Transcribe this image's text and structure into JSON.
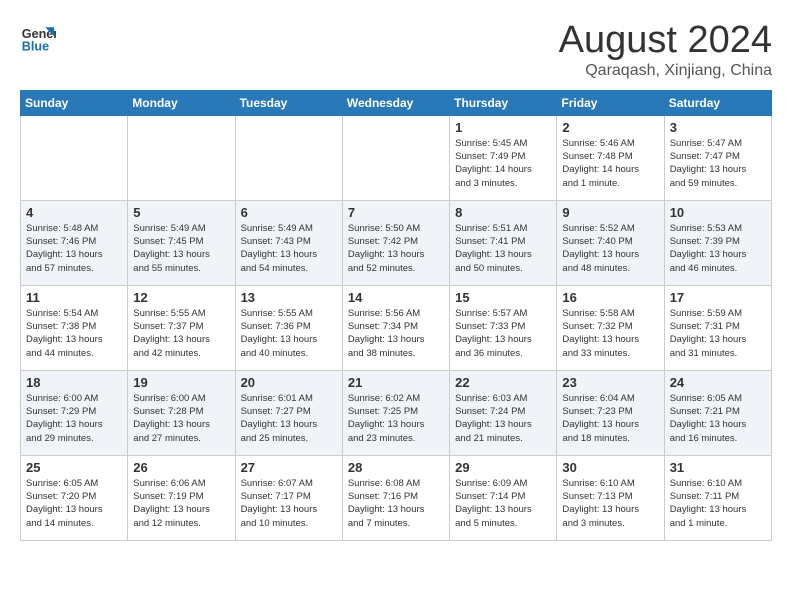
{
  "header": {
    "logo_line1": "General",
    "logo_line2": "Blue",
    "month": "August 2024",
    "location": "Qaraqash, Xinjiang, China"
  },
  "weekdays": [
    "Sunday",
    "Monday",
    "Tuesday",
    "Wednesday",
    "Thursday",
    "Friday",
    "Saturday"
  ],
  "weeks": [
    [
      {
        "day": "",
        "info": ""
      },
      {
        "day": "",
        "info": ""
      },
      {
        "day": "",
        "info": ""
      },
      {
        "day": "",
        "info": ""
      },
      {
        "day": "1",
        "info": "Sunrise: 5:45 AM\nSunset: 7:49 PM\nDaylight: 14 hours\nand 3 minutes."
      },
      {
        "day": "2",
        "info": "Sunrise: 5:46 AM\nSunset: 7:48 PM\nDaylight: 14 hours\nand 1 minute."
      },
      {
        "day": "3",
        "info": "Sunrise: 5:47 AM\nSunset: 7:47 PM\nDaylight: 13 hours\nand 59 minutes."
      }
    ],
    [
      {
        "day": "4",
        "info": "Sunrise: 5:48 AM\nSunset: 7:46 PM\nDaylight: 13 hours\nand 57 minutes."
      },
      {
        "day": "5",
        "info": "Sunrise: 5:49 AM\nSunset: 7:45 PM\nDaylight: 13 hours\nand 55 minutes."
      },
      {
        "day": "6",
        "info": "Sunrise: 5:49 AM\nSunset: 7:43 PM\nDaylight: 13 hours\nand 54 minutes."
      },
      {
        "day": "7",
        "info": "Sunrise: 5:50 AM\nSunset: 7:42 PM\nDaylight: 13 hours\nand 52 minutes."
      },
      {
        "day": "8",
        "info": "Sunrise: 5:51 AM\nSunset: 7:41 PM\nDaylight: 13 hours\nand 50 minutes."
      },
      {
        "day": "9",
        "info": "Sunrise: 5:52 AM\nSunset: 7:40 PM\nDaylight: 13 hours\nand 48 minutes."
      },
      {
        "day": "10",
        "info": "Sunrise: 5:53 AM\nSunset: 7:39 PM\nDaylight: 13 hours\nand 46 minutes."
      }
    ],
    [
      {
        "day": "11",
        "info": "Sunrise: 5:54 AM\nSunset: 7:38 PM\nDaylight: 13 hours\nand 44 minutes."
      },
      {
        "day": "12",
        "info": "Sunrise: 5:55 AM\nSunset: 7:37 PM\nDaylight: 13 hours\nand 42 minutes."
      },
      {
        "day": "13",
        "info": "Sunrise: 5:55 AM\nSunset: 7:36 PM\nDaylight: 13 hours\nand 40 minutes."
      },
      {
        "day": "14",
        "info": "Sunrise: 5:56 AM\nSunset: 7:34 PM\nDaylight: 13 hours\nand 38 minutes."
      },
      {
        "day": "15",
        "info": "Sunrise: 5:57 AM\nSunset: 7:33 PM\nDaylight: 13 hours\nand 36 minutes."
      },
      {
        "day": "16",
        "info": "Sunrise: 5:58 AM\nSunset: 7:32 PM\nDaylight: 13 hours\nand 33 minutes."
      },
      {
        "day": "17",
        "info": "Sunrise: 5:59 AM\nSunset: 7:31 PM\nDaylight: 13 hours\nand 31 minutes."
      }
    ],
    [
      {
        "day": "18",
        "info": "Sunrise: 6:00 AM\nSunset: 7:29 PM\nDaylight: 13 hours\nand 29 minutes."
      },
      {
        "day": "19",
        "info": "Sunrise: 6:00 AM\nSunset: 7:28 PM\nDaylight: 13 hours\nand 27 minutes."
      },
      {
        "day": "20",
        "info": "Sunrise: 6:01 AM\nSunset: 7:27 PM\nDaylight: 13 hours\nand 25 minutes."
      },
      {
        "day": "21",
        "info": "Sunrise: 6:02 AM\nSunset: 7:25 PM\nDaylight: 13 hours\nand 23 minutes."
      },
      {
        "day": "22",
        "info": "Sunrise: 6:03 AM\nSunset: 7:24 PM\nDaylight: 13 hours\nand 21 minutes."
      },
      {
        "day": "23",
        "info": "Sunrise: 6:04 AM\nSunset: 7:23 PM\nDaylight: 13 hours\nand 18 minutes."
      },
      {
        "day": "24",
        "info": "Sunrise: 6:05 AM\nSunset: 7:21 PM\nDaylight: 13 hours\nand 16 minutes."
      }
    ],
    [
      {
        "day": "25",
        "info": "Sunrise: 6:05 AM\nSunset: 7:20 PM\nDaylight: 13 hours\nand 14 minutes."
      },
      {
        "day": "26",
        "info": "Sunrise: 6:06 AM\nSunset: 7:19 PM\nDaylight: 13 hours\nand 12 minutes."
      },
      {
        "day": "27",
        "info": "Sunrise: 6:07 AM\nSunset: 7:17 PM\nDaylight: 13 hours\nand 10 minutes."
      },
      {
        "day": "28",
        "info": "Sunrise: 6:08 AM\nSunset: 7:16 PM\nDaylight: 13 hours\nand 7 minutes."
      },
      {
        "day": "29",
        "info": "Sunrise: 6:09 AM\nSunset: 7:14 PM\nDaylight: 13 hours\nand 5 minutes."
      },
      {
        "day": "30",
        "info": "Sunrise: 6:10 AM\nSunset: 7:13 PM\nDaylight: 13 hours\nand 3 minutes."
      },
      {
        "day": "31",
        "info": "Sunrise: 6:10 AM\nSunset: 7:11 PM\nDaylight: 13 hours\nand 1 minute."
      }
    ]
  ]
}
